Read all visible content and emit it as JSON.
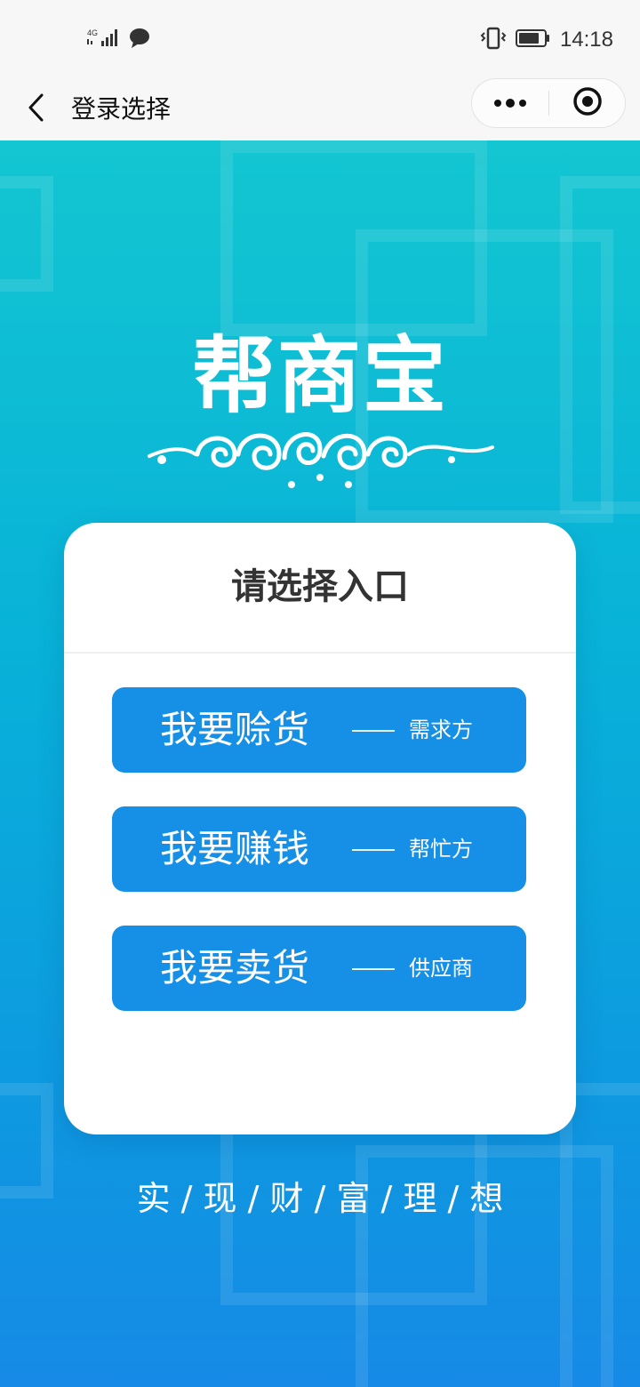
{
  "status_bar": {
    "network": "4G",
    "time": "14:18",
    "icons": [
      "signal-icon",
      "chat-bubble-icon",
      "vibrate-icon",
      "battery-icon"
    ]
  },
  "nav": {
    "title": "登录选择",
    "back_icon": "chevron-left-icon",
    "more_icon": "more-dots-icon",
    "close_icon": "target-circle-icon"
  },
  "logo": {
    "brand": "帮商宝"
  },
  "card": {
    "title": "请选择入口",
    "options": [
      {
        "label": "我要赊货",
        "role": "需求方"
      },
      {
        "label": "我要赚钱",
        "role": "帮忙方"
      },
      {
        "label": "我要卖货",
        "role": "供应商"
      }
    ]
  },
  "slogan": "实 / 现 / 财 / 富 / 理 / 想",
  "colors": {
    "bar_bg": "#f7f7f7",
    "gradient_top": "#13c6d1",
    "gradient_bottom": "#168ae6",
    "button_blue": "#1690e7",
    "card_bg": "#ffffff",
    "title_text": "#333333"
  }
}
